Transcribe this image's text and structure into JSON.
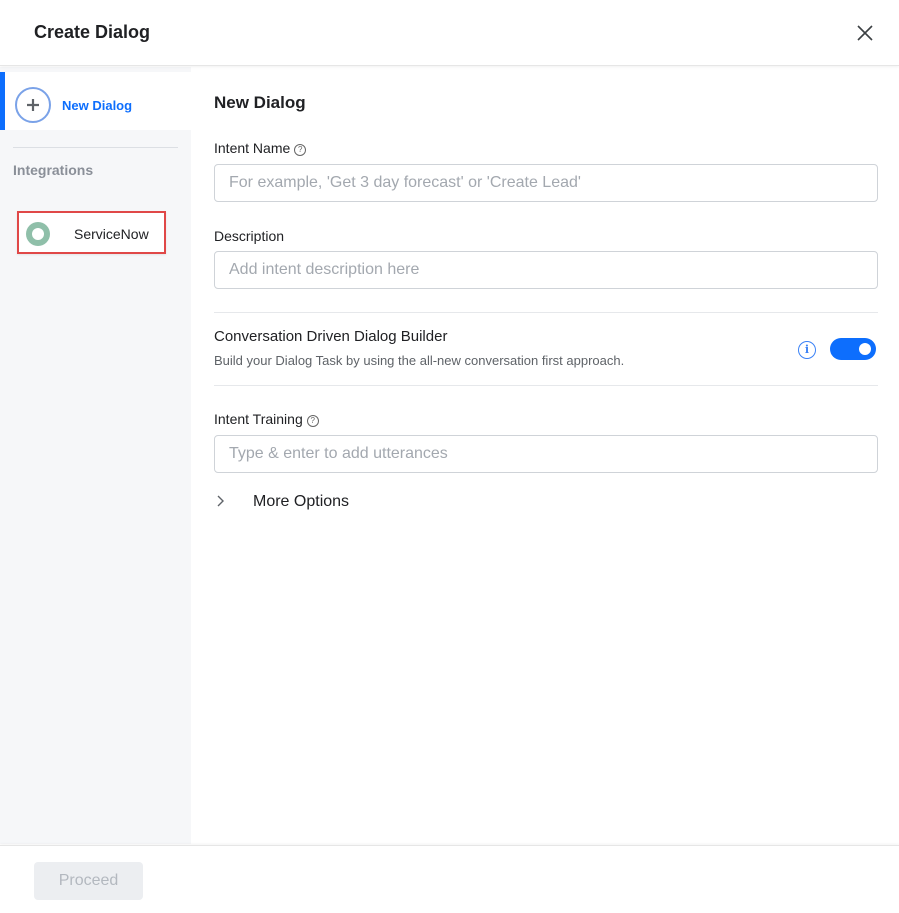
{
  "header": {
    "title": "Create Dialog"
  },
  "sidebar": {
    "new_dialog_label": "New Dialog",
    "section_title": "Integrations",
    "integrations": [
      {
        "label": "ServiceNow"
      }
    ]
  },
  "main": {
    "heading": "New Dialog",
    "intent_name": {
      "label": "Intent Name",
      "placeholder": "For example, 'Get 3 day forecast' or 'Create Lead'",
      "value": ""
    },
    "description": {
      "label": "Description",
      "placeholder": "Add intent description here",
      "value": ""
    },
    "builder": {
      "title": "Conversation Driven Dialog Builder",
      "subtitle": "Build your Dialog Task by using the all-new conversation first approach.",
      "info_glyph": "i",
      "enabled": true
    },
    "intent_training": {
      "label": "Intent Training",
      "placeholder": "Type & enter to add utterances",
      "value": ""
    },
    "more_options_label": "More Options"
  },
  "footer": {
    "proceed_label": "Proceed"
  },
  "colors": {
    "accent": "#0d6efd",
    "highlight_border": "#e04848",
    "disabled_bg": "#eceef1"
  },
  "icons": {
    "help": "?"
  }
}
